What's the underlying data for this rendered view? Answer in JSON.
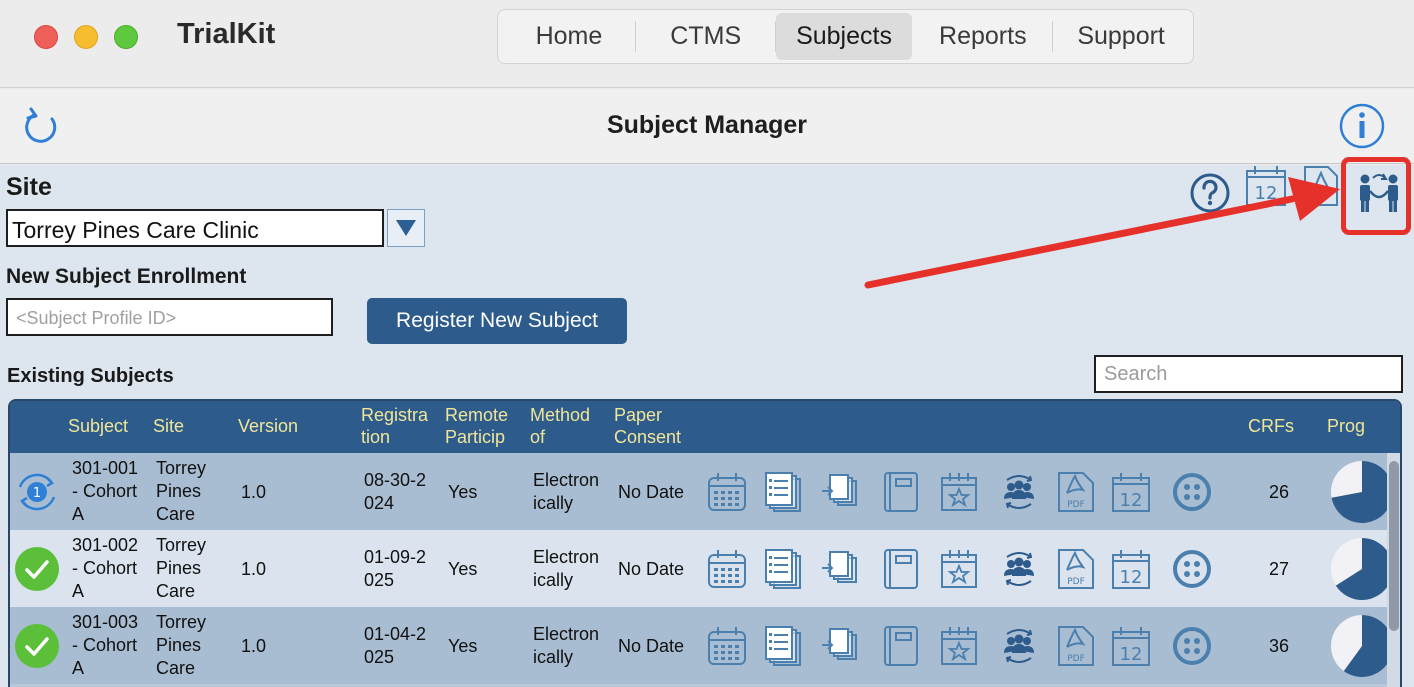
{
  "app": {
    "title": "TrialKit"
  },
  "nav": {
    "tabs": [
      {
        "label": "Home"
      },
      {
        "label": "CTMS"
      },
      {
        "label": "Subjects"
      },
      {
        "label": "Reports"
      },
      {
        "label": "Support"
      }
    ],
    "active": "Subjects"
  },
  "toolbar": {
    "title": "Subject Manager"
  },
  "site": {
    "label": "Site",
    "selected": "Torrey Pines Care Clinic"
  },
  "enrollment": {
    "label": "New Subject Enrollment",
    "placeholder": "<Subject Profile ID>",
    "button_label": "Register New Subject"
  },
  "existing": {
    "label": "Existing Subjects",
    "search_placeholder": "Search"
  },
  "table": {
    "headers": {
      "subject": "Subject",
      "site": "Site",
      "version": "Version",
      "registration_1": "Registra",
      "registration_2": "tion",
      "remote_1": "Remote",
      "remote_2": "Particip",
      "method_1": "Method",
      "method_2": "of",
      "paper_1": "Paper",
      "paper_2": "Consent",
      "crfs": "CRFs",
      "prog": "Prog"
    },
    "rows": [
      {
        "status": "sync",
        "badge": "1",
        "subject_1": "301-001",
        "subject_2": "- Cohort",
        "subject_3": "A",
        "site_1": "Torrey",
        "site_2": "Pines",
        "site_3": "Care",
        "version": "1.0",
        "reg_1": "08-30-2",
        "reg_2": "024",
        "remote": "Yes",
        "method_1": "Electron",
        "method_2": "ically",
        "paper": "No Date",
        "crfs": "26",
        "progress": 0.72
      },
      {
        "status": "complete",
        "subject_1": "301-002",
        "subject_2": "- Cohort",
        "subject_3": "A",
        "site_1": "Torrey",
        "site_2": "Pines",
        "site_3": "Care",
        "version": "1.0",
        "reg_1": "01-09-2",
        "reg_2": "025",
        "remote": "Yes",
        "method_1": "Electron",
        "method_2": "ically",
        "paper": "No Date",
        "crfs": "27",
        "progress": 0.66
      },
      {
        "status": "complete",
        "subject_1": "301-003",
        "subject_2": "- Cohort",
        "subject_3": "A",
        "site_1": "Torrey",
        "site_2": "Pines",
        "site_3": "Care",
        "version": "1.0",
        "reg_1": "01-04-2",
        "reg_2": "025",
        "remote": "Yes",
        "method_1": "Electron",
        "method_2": "ically",
        "paper": "No Date",
        "crfs": "36",
        "progress": 0.6
      }
    ]
  },
  "icons": {
    "calendar_day": "12",
    "pdf_label": "PDF"
  },
  "colors": {
    "header_bg": "#2d5b8c",
    "header_text": "#f0e69a",
    "accent": "#2f6fb5",
    "highlight": "#e6312b",
    "success": "#5bbf3a"
  }
}
